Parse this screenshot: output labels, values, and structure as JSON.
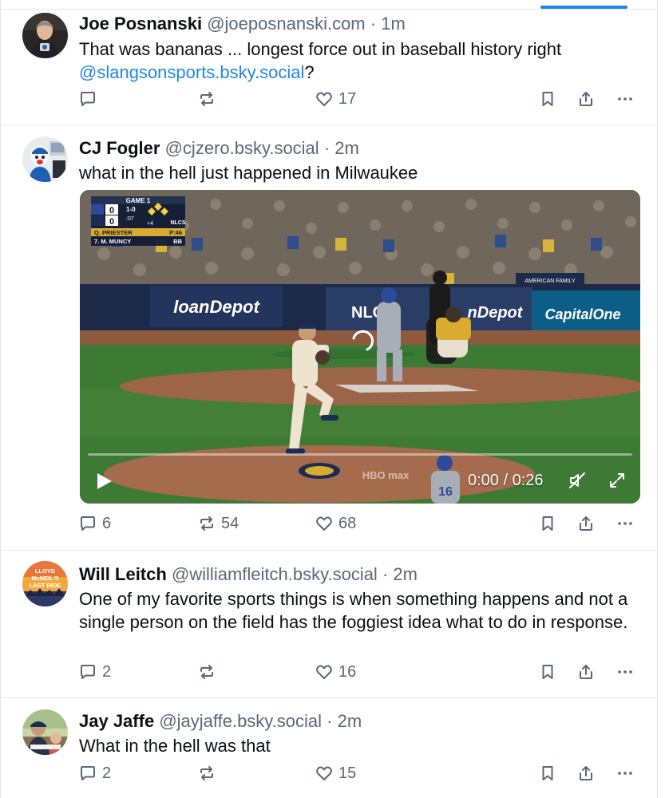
{
  "feed": {
    "active_tab_color": "#1f86e6",
    "posts": [
      {
        "author": "Joe Posnanski",
        "handle": "@joeposnanski.com",
        "separator": "·",
        "time": "1m",
        "text": "That was bananas ... longest force out in baseball history right ",
        "mention": "@slangsonsports.bsky.social",
        "text_after_mention": "?",
        "replies": "",
        "reposts": "",
        "likes": "17"
      },
      {
        "author": "CJ Fogler",
        "handle": "@cjzero.bsky.social",
        "separator": "·",
        "time": "2m",
        "text": "what in the hell just happened in Milwaukee",
        "replies": "6",
        "reposts": "54",
        "likes": "68",
        "video": {
          "current_time": "0:00",
          "duration": "0:26",
          "time_display": "0:00 / 0:26",
          "progress": 0,
          "scorebug": {
            "game": "GAME 1",
            "series": "1-0",
            "team1_score": "0",
            "team2_score": "0",
            "clock": ":07",
            "pitch_count_label": "+4",
            "league": "NLCS",
            "pitcher": "Q. PRIESTER",
            "pitcher_stat": "P:46",
            "batter": "7. M. MUNCY",
            "batter_stat": "BB"
          },
          "signage": {
            "board1": "loanDepot",
            "board2": "NLC",
            "board3": "nDepot",
            "board4": "CapitalOne",
            "board5": "AMERICAN FAMILY",
            "watermark": "HBO max"
          }
        }
      },
      {
        "author": "Will Leitch",
        "handle": "@williamfleitch.bsky.social",
        "separator": "·",
        "time": "2m",
        "text": "One of my favorite sports things is when something happens and not a single person on the field has the foggiest idea what to do in response.",
        "avatar_text": "LLOYD McNEIL'S LAST RIDE",
        "replies": "2",
        "reposts": "",
        "likes": "16"
      },
      {
        "author": "Jay Jaffe",
        "handle": "@jayjaffe.bsky.social",
        "separator": "·",
        "time": "2m",
        "text": "What in the hell was that",
        "replies": "2",
        "reposts": "",
        "likes": "15"
      }
    ]
  },
  "icons": {
    "reply": "speech-bubble-icon",
    "repost": "repost-arrows-icon",
    "like": "heart-icon",
    "bookmark": "bookmark-icon",
    "share": "share-icon",
    "more": "ellipsis-icon",
    "play": "play-icon",
    "mute": "muted-speaker-icon",
    "fullscreen": "fullscreen-icon",
    "loading": "loading-spinner-icon"
  }
}
